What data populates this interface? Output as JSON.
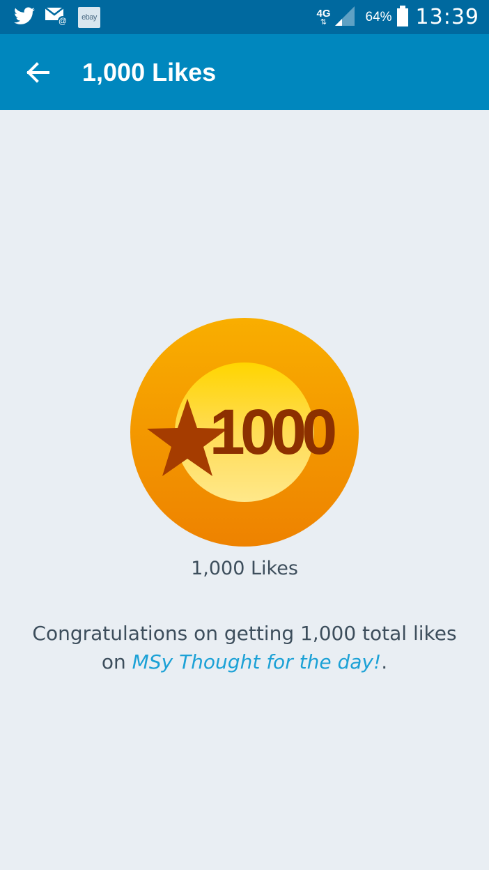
{
  "status_bar": {
    "notification_icons": [
      "twitter-icon",
      "mail-icon",
      "ebay-icon"
    ],
    "ebay_text": "ebay",
    "network_type": "4G",
    "network_arrows": "⇅",
    "battery_percent": "64%",
    "time": "13:39"
  },
  "app_bar": {
    "back_icon": "arrow-left-icon",
    "title": "1,000 Likes"
  },
  "achievement": {
    "badge_number": "1000",
    "badge_icon": "star-icon",
    "label": "1,000 Likes",
    "message_prefix": "Congratulations on getting 1,000 total likes on ",
    "site_name": "MSy Thought for the day!",
    "message_suffix": "."
  },
  "colors": {
    "status_bar": "#00699f",
    "app_bar": "#0087be",
    "background": "#e9eef3",
    "link": "#1ba1d6",
    "text": "#3d4e5c",
    "badge_outer": "#f7a300",
    "badge_inner": "#ffd700",
    "badge_star": "#a53c00"
  }
}
